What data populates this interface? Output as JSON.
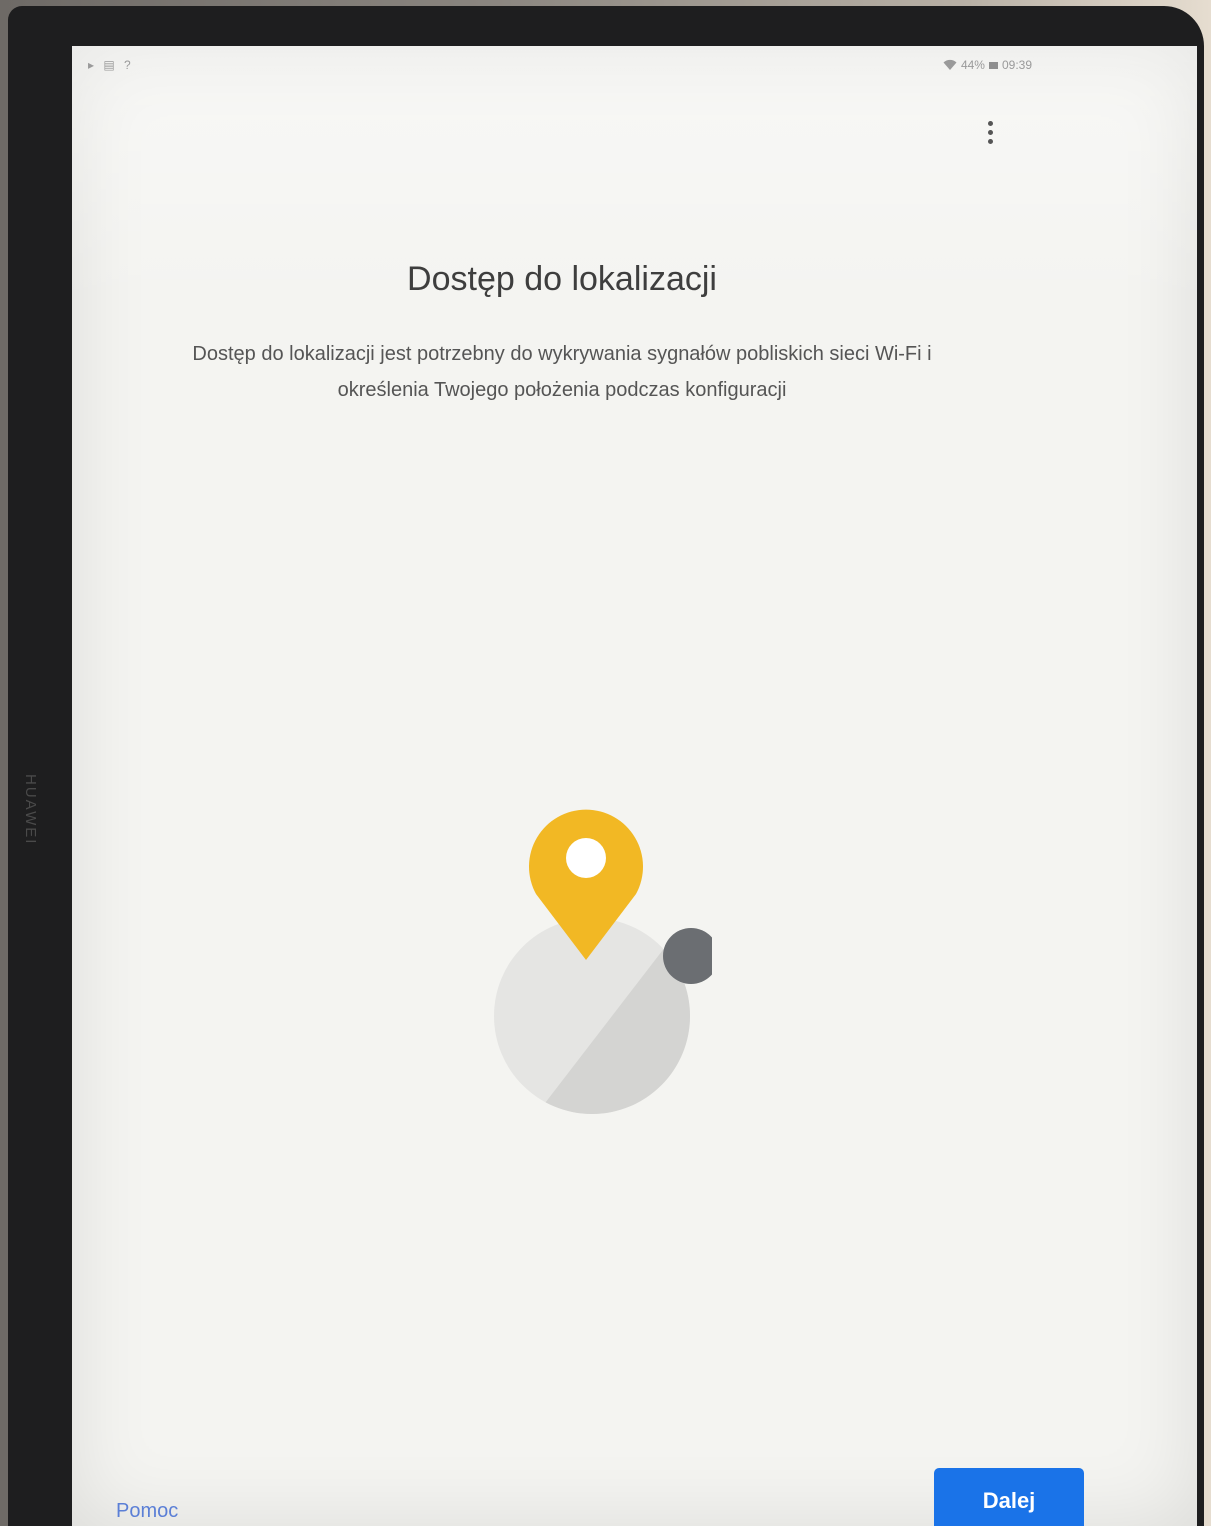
{
  "device": {
    "brand_label": "HUAWEI"
  },
  "status_bar": {
    "left_icons": "▸ ▤ ?",
    "battery_percent": "44%",
    "time": "09:39"
  },
  "header": {
    "menu_icon": "more-vert-icon"
  },
  "main": {
    "title": "Dostęp do lokalizacji",
    "description": "Dostęp do lokalizacji jest potrzebny do wykrywania sygnałów pobliskich sieci Wi-Fi i określenia Twojego położenia podczas konfiguracji"
  },
  "illustration": {
    "pin_color": "#f2b824",
    "dot_color": "#6b6e72",
    "globe_light": "#e5e5e3",
    "globe_dark": "#d4d4d2"
  },
  "footer": {
    "help_label": "Pomoc",
    "next_label": "Dalej",
    "accent_color": "#1a73e8"
  }
}
